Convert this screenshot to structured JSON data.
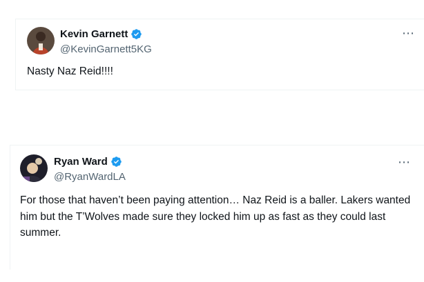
{
  "tweets": [
    {
      "display_name": "Kevin Garnett",
      "handle": "@KevinGarnett5KG",
      "text": "Nasty Naz Reid!!!!",
      "verified": true,
      "more_icon": "⋯"
    },
    {
      "display_name": "Ryan Ward",
      "handle": "@RyanWardLA",
      "text": "For those that haven’t been paying attention… Naz Reid is a baller. Lakers wanted him but the T’Wolves made sure they locked him up as fast as they could last summer.",
      "verified": true,
      "more_icon": "⋯"
    }
  ],
  "colors": {
    "verified_blue": "#1d9bf0",
    "secondary_text": "#536471",
    "primary_text": "#0f1419",
    "border": "#eff3f4"
  }
}
